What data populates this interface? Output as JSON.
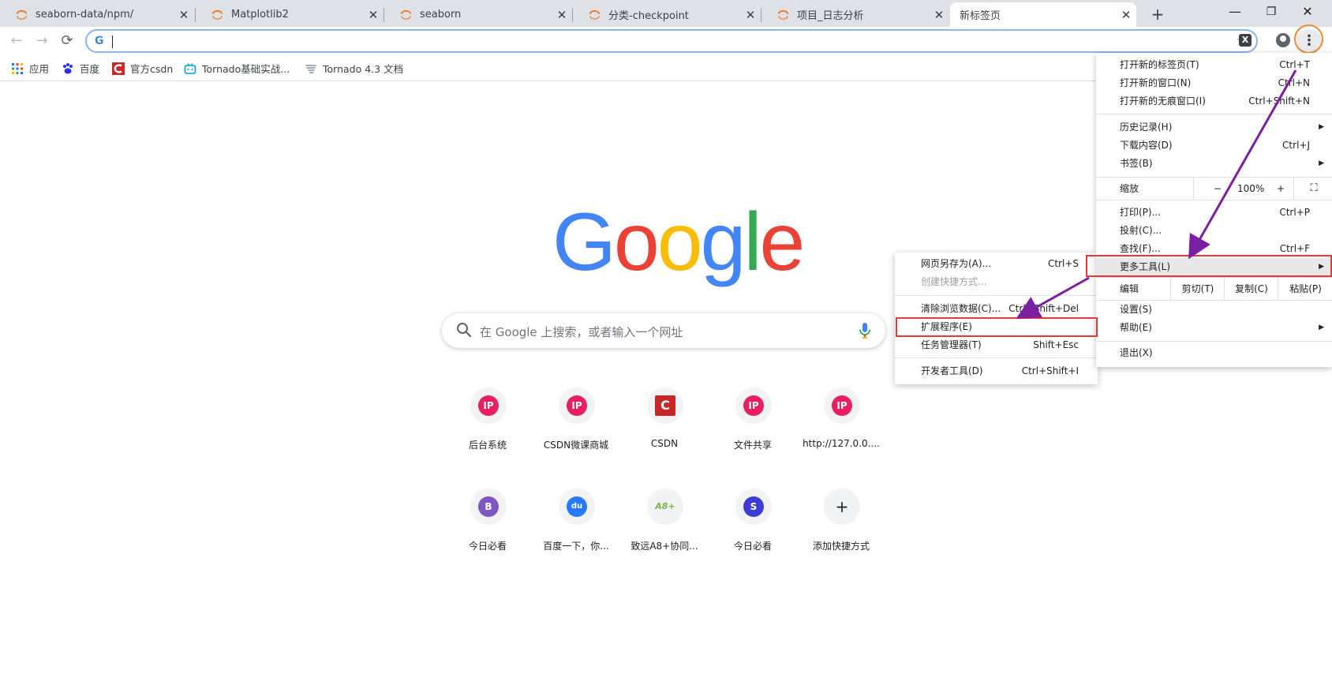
{
  "tabs": [
    {
      "title": "seaborn-data/npm/"
    },
    {
      "title": "Matplotlib2"
    },
    {
      "title": "seaborn"
    },
    {
      "title": "分类-checkpoint"
    },
    {
      "title": "项目_日志分析"
    },
    {
      "title": "新标签页"
    }
  ],
  "colors": {
    "accent": "#4285f4",
    "annotation_arrow": "#7b1fa2",
    "highlight_box": "#e53935",
    "menu_ring": "#f08a2c"
  },
  "bookmarks": [
    {
      "label": "应用"
    },
    {
      "label": "百度"
    },
    {
      "label": "官方csdn"
    },
    {
      "label": "Tornado基础实战..."
    },
    {
      "label": "Tornado 4.3 文档"
    }
  ],
  "logo": {
    "letters": [
      "G",
      "o",
      "o",
      "g",
      "l",
      "e"
    ]
  },
  "search": {
    "placeholder": "在 Google 上搜索，或者输入一个网址"
  },
  "shortcuts": [
    {
      "badge": "IP",
      "label": "后台系统",
      "color": "#e91e63"
    },
    {
      "badge": "IP",
      "label": "CSDN微课商城",
      "color": "#e91e63"
    },
    {
      "badge": "C",
      "label": "CSDN",
      "color": "#c62828"
    },
    {
      "badge": "IP",
      "label": "文件共享",
      "color": "#e91e63"
    },
    {
      "badge": "IP",
      "label": "http://127.0.0....",
      "color": "#e91e63"
    },
    {
      "badge": "B",
      "label": "今日必看",
      "color": "#7e57c2"
    },
    {
      "badge": "du",
      "label": "百度一下，你...",
      "color": "#2979ff"
    },
    {
      "badge": "A8+",
      "label": "致远A8+协同...",
      "color": "#8bc34a"
    },
    {
      "badge": "S",
      "label": "今日必看",
      "color": "#3d3dd6"
    },
    {
      "badge": "+",
      "label": "添加快捷方式",
      "color": "#f1f3f4"
    }
  ],
  "main_menu": {
    "new_tab": {
      "label": "打开新的标签页(T)",
      "shortcut": "Ctrl+T"
    },
    "new_window": {
      "label": "打开新的窗口(N)",
      "shortcut": "Ctrl+N"
    },
    "incognito": {
      "label": "打开新的无痕窗口(I)",
      "shortcut": "Ctrl+Shift+N"
    },
    "history": {
      "label": "历史记录(H)"
    },
    "downloads": {
      "label": "下载内容(D)",
      "shortcut": "Ctrl+J"
    },
    "bookmarks": {
      "label": "书签(B)"
    },
    "zoom": {
      "label": "缩放",
      "minus": "−",
      "value": "100%",
      "plus": "+"
    },
    "print": {
      "label": "打印(P)...",
      "shortcut": "Ctrl+P"
    },
    "cast": {
      "label": "投射(C)..."
    },
    "find": {
      "label": "查找(F)...",
      "shortcut": "Ctrl+F"
    },
    "more_tools": {
      "label": "更多工具(L)"
    },
    "edit": {
      "label": "编辑",
      "cut": "剪切(T)",
      "copy": "复制(C)",
      "paste": "粘贴(P)"
    },
    "settings": {
      "label": "设置(S)"
    },
    "help": {
      "label": "帮助(E)"
    },
    "exit": {
      "label": "退出(X)"
    }
  },
  "sub_menu": {
    "save_page": {
      "label": "网页另存为(A)...",
      "shortcut": "Ctrl+S"
    },
    "create_shortcut": {
      "label": "创建快捷方式..."
    },
    "clear_data": {
      "label": "清除浏览数据(C)...",
      "shortcut": "Ctrl+Shift+Del"
    },
    "extensions": {
      "label": "扩展程序(E)"
    },
    "task_manager": {
      "label": "任务管理器(T)",
      "shortcut": "Shift+Esc"
    },
    "dev_tools": {
      "label": "开发者工具(D)",
      "shortcut": "Ctrl+Shift+I"
    }
  }
}
